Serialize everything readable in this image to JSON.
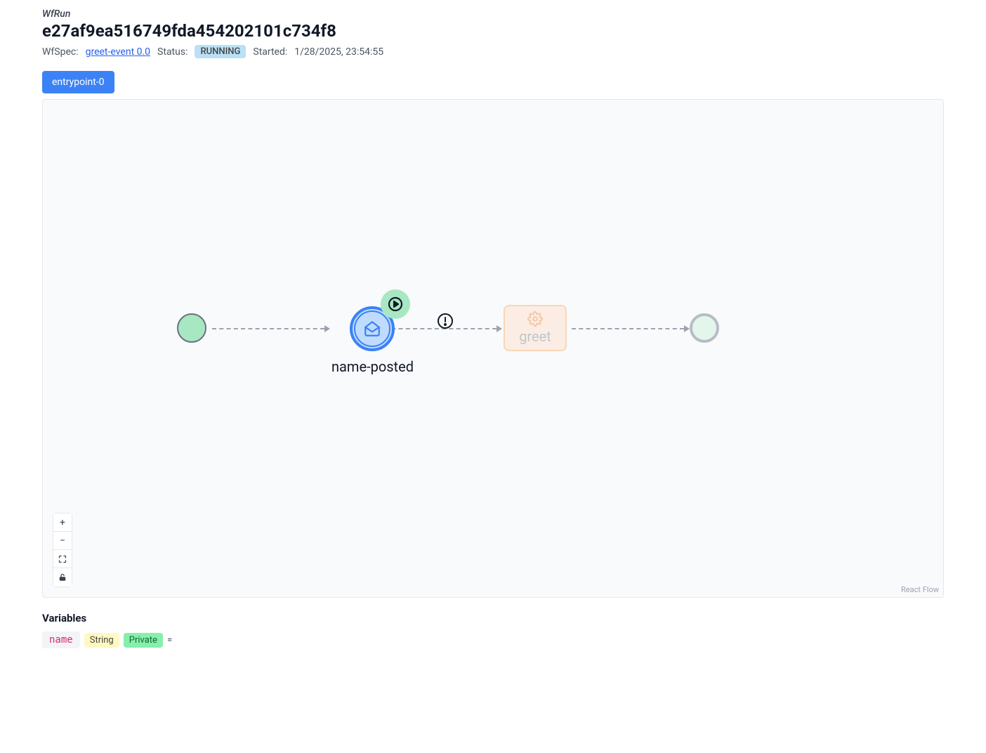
{
  "header": {
    "resource_type": "WfRun",
    "resource_id": "e27af9ea516749fda454202101c734f8",
    "wfspec_label": "WfSpec:",
    "wfspec_link": "greet-event 0.0",
    "status_label": "Status:",
    "status_value": "RUNNING",
    "started_label": "Started:",
    "started_value": "1/28/2025, 23:54:55"
  },
  "tabs": {
    "active": "entrypoint-0"
  },
  "flow": {
    "nodes": {
      "event_label": "name-posted",
      "task_label": "greet"
    },
    "attribution": "React Flow"
  },
  "controls": {
    "zoom_in": "+",
    "zoom_out": "−"
  },
  "variables": {
    "title": "Variables",
    "items": [
      {
        "name": "name",
        "type": "String",
        "access": "Private",
        "equals": "="
      }
    ]
  }
}
